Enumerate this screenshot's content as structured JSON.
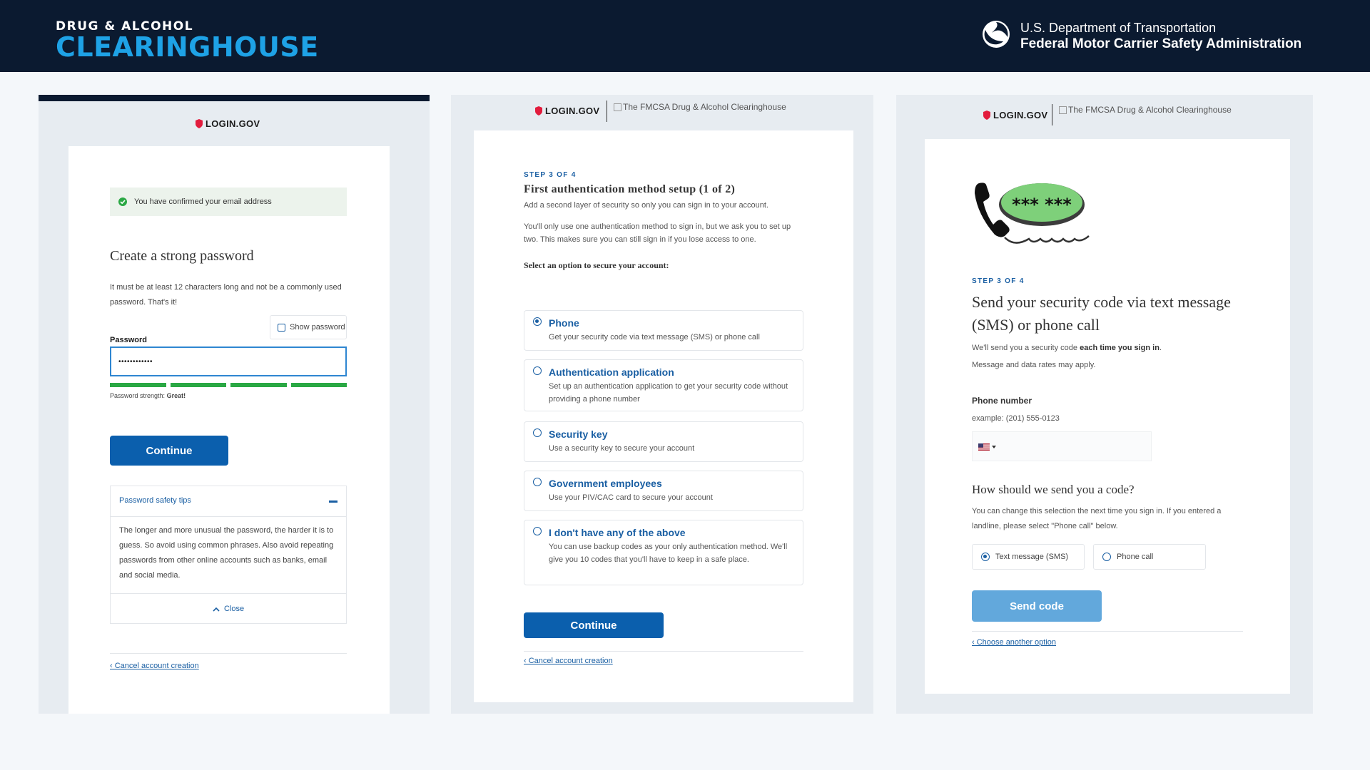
{
  "header": {
    "brand_line1": "DRUG & ALCOHOL",
    "brand_line2": "CLEARINGHOUSE",
    "agency_line1": "U.S. Department of Transportation",
    "agency_line2": "Federal Motor Carrier Safety Administration"
  },
  "logo_text": "LOGIN.GOV",
  "broken_img_alt": "The FMCSA Drug & Alcohol Clearinghouse",
  "screen1": {
    "alert": "You have confirmed your email address",
    "heading": "Create a strong password",
    "description": "It must be at least 12 characters long and not be a commonly used password. That's it!",
    "show_password_label": "Show password",
    "password_label": "Password",
    "password_value": "••••••••••••",
    "strength_label": "Password strength:",
    "strength_value": "Great!",
    "continue_label": "Continue",
    "tips_title": "Password safety tips",
    "tips_body": "The longer and more unusual the password, the harder it is to guess. So avoid using common phrases. Also avoid repeating passwords from other online accounts such as banks, email and social media.",
    "close_label": "Close",
    "cancel_label": "‹ Cancel account creation"
  },
  "screen2": {
    "step": "STEP 3 OF 4",
    "heading": "First authentication method setup (1 of 2)",
    "intro": "Add a second layer of security so only you can sign in to your account.",
    "note": "You'll only use one authentication method to sign in, but we ask you to set up two. This makes sure you can still sign in if you lose access to one.",
    "select_label": "Select an option to secure your account:",
    "options": [
      {
        "title": "Phone",
        "desc": "Get your security code via text message (SMS) or phone call",
        "selected": true
      },
      {
        "title": "Authentication application",
        "desc": "Set up an authentication application to get your security code without providing a phone number",
        "selected": false
      },
      {
        "title": "Security key",
        "desc": "Use a security key to secure your account",
        "selected": false
      },
      {
        "title": "Government employees",
        "desc": "Use your PIV/CAC card to secure your account",
        "selected": false
      },
      {
        "title": "I don't have any of the above",
        "desc": "You can use backup codes as your only authentication method. We'll give you 10 codes that you'll have to keep in a safe place.",
        "selected": false
      }
    ],
    "continue_label": "Continue",
    "cancel_label": "‹ Cancel account creation"
  },
  "screen3": {
    "bubble_text": "*** ***",
    "step": "STEP 3 OF 4",
    "heading": "Send your security code via text message (SMS) or phone call",
    "intro_pre": "We'll send you a security code ",
    "intro_bold": "each time you sign in",
    "intro_post": ".",
    "rates": "Message and data rates may apply.",
    "phone_label": "Phone number",
    "phone_example": "example: (201) 555-0123",
    "how_heading": "How should we send you a code?",
    "how_desc": "You can change this selection the next time you sign in. If you entered a landline, please select \"Phone call\" below.",
    "option_sms": "Text message (SMS)",
    "option_call": "Phone call",
    "send_label": "Send code",
    "choose_label": "‹ Choose another option"
  },
  "colors": {
    "header_bg": "#0b1a30",
    "brand_blue": "#1ea2e6",
    "primary": "#0b5fad",
    "success": "#2aa844",
    "send_button": "#62a8dc"
  }
}
